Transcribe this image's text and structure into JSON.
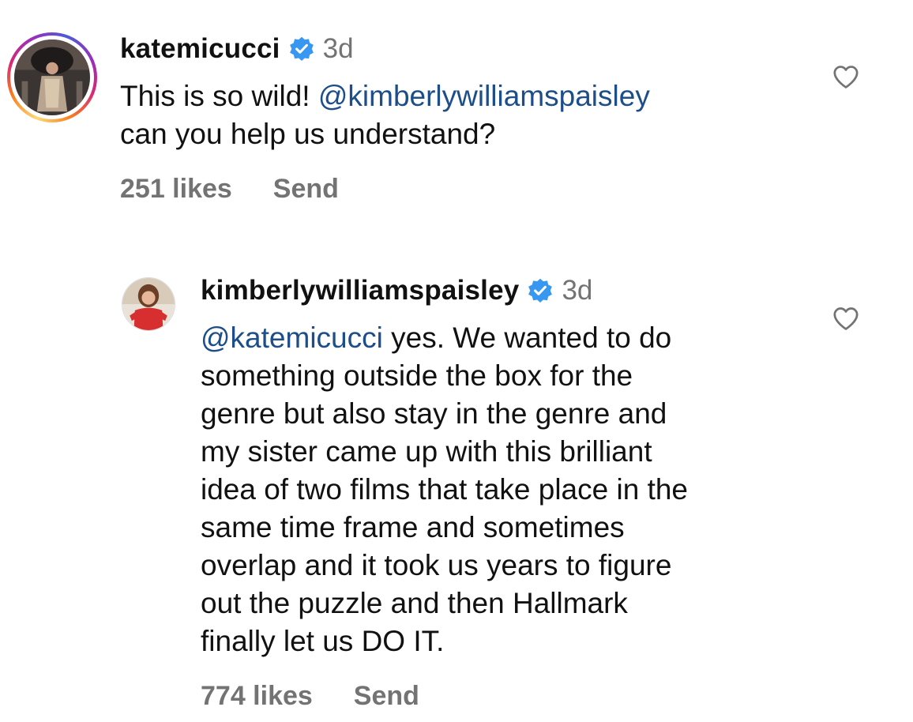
{
  "comments": [
    {
      "username": "katemicucci",
      "time": "3d",
      "mention": "@kimberlywilliamspaisley",
      "text_before": "This is so wild! ",
      "text_after": "\ncan you help us understand?",
      "likes": "251 likes",
      "send": "Send",
      "verified": true,
      "avatar_has_story_ring": true
    },
    {
      "username": "kimberlywilliamspaisley",
      "time": "3d",
      "mention": "@katemicucci",
      "text_before": "",
      "text_after": " yes. We wanted to do\nsomething outside the box for the\ngenre but also stay in the genre and\nmy sister came up with this brilliant\nidea of two films that take place in the\nsame time frame and sometimes\noverlap and it took us years to figure\nout the puzzle and then Hallmark\nfinally let us DO IT.",
      "likes": "774 likes",
      "send": "Send",
      "verified": true,
      "avatar_has_story_ring": false
    }
  ],
  "colors": {
    "mention": "#1d4e89",
    "verified_badge": "#3897f0",
    "meta_gray": "#737373"
  },
  "icons": {
    "like": "heart-outline-icon",
    "verified": "verified-badge-icon"
  }
}
